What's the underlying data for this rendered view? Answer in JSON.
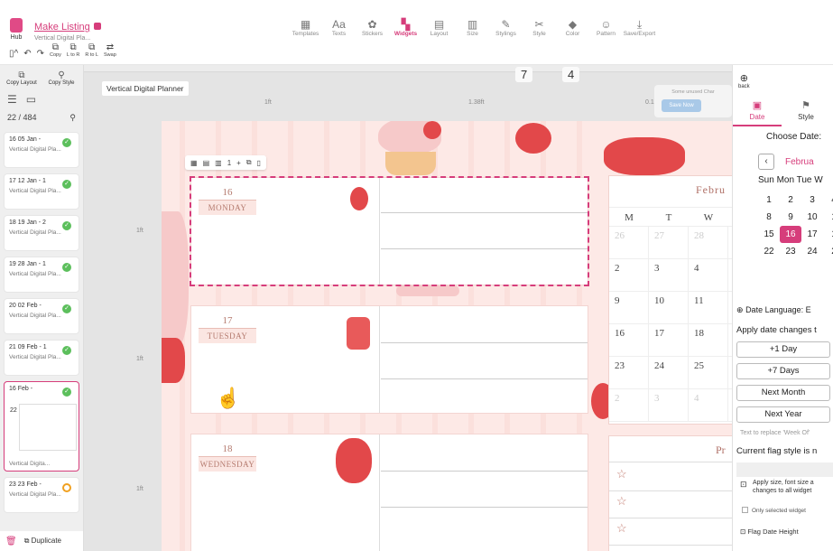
{
  "header": {
    "hub_label": "Hub",
    "title": "Make Listing",
    "subtitle": "Vertical Digital Pla...",
    "undo_items": [
      {
        "icon": "undo-icon",
        "label": ""
      },
      {
        "icon": "redo-icon",
        "label": ""
      },
      {
        "icon": "copy-icon",
        "label": "Copy"
      },
      {
        "icon": "left-to-right-icon",
        "label": "L to R"
      },
      {
        "icon": "right-to-left-icon",
        "label": "R to L"
      },
      {
        "icon": "swap-icon",
        "label": "Swap"
      }
    ],
    "tools": [
      {
        "label": "Templates",
        "icon": "templates-icon",
        "active": false
      },
      {
        "label": "Texts",
        "icon": "texts-icon",
        "active": false
      },
      {
        "label": "Stickers",
        "icon": "stickers-icon",
        "active": false
      },
      {
        "label": "Widgets",
        "icon": "widgets-icon",
        "active": true
      },
      {
        "label": "Layout",
        "icon": "layout-icon",
        "active": false
      },
      {
        "label": "Size",
        "icon": "size-icon",
        "active": false
      },
      {
        "label": "Stylings",
        "icon": "stylings-icon",
        "active": false
      },
      {
        "label": "Style",
        "icon": "style-icon",
        "active": false
      },
      {
        "label": "Color",
        "icon": "color-icon",
        "active": false
      },
      {
        "label": "Pattern",
        "icon": "pattern-icon",
        "active": false
      },
      {
        "label": "Save/Export",
        "icon": "save-export-icon",
        "active": false
      }
    ]
  },
  "sidebar": {
    "copy_layout": "Copy Layout",
    "copy_style": "Copy Style",
    "count": "22 / 484",
    "pages": [
      {
        "date": "16 05 Jan -",
        "name": "Vertical Digital Pla...",
        "status": "done"
      },
      {
        "date": "17 12 Jan - 1",
        "name": "Vertical Digital Pla...",
        "status": "done"
      },
      {
        "date": "18 19 Jan - 2",
        "name": "Vertical Digital Pla...",
        "status": "done"
      },
      {
        "date": "19 28 Jan - 1",
        "name": "Vertical Digital Pla...",
        "status": "done"
      },
      {
        "date": "20 02 Feb -",
        "name": "Vertical Digital Pla...",
        "status": "done"
      },
      {
        "date": "21 09 Feb - 1",
        "name": "Vertical Digital Pla...",
        "status": "done"
      }
    ],
    "selected_page": {
      "date": "16 Feb -",
      "num": "22",
      "name": "Vertical Digita..."
    },
    "last_page": {
      "date": "23 23 Feb -",
      "name": "Vertical Digital Pla...",
      "status": "pending"
    },
    "duplicate_label": "Duplicate"
  },
  "canvas": {
    "label": "Vertical Digital Planner",
    "coord_x": "7",
    "coord_y": "4",
    "ruler_labels": [
      "1ft",
      "1.38ft",
      "0.1"
    ],
    "side_labels": [
      "1ft",
      "1ft",
      "1ft"
    ],
    "unused_text": "Some unused Char",
    "unused_button": "Save Now",
    "mini_toolbar": [
      "1",
      "+"
    ],
    "days": [
      {
        "num": "16",
        "name": "MONDAY",
        "selected": true
      },
      {
        "num": "17",
        "name": "TUESDAY",
        "selected": false
      },
      {
        "num": "18",
        "name": "WEDNESDAY",
        "selected": false
      }
    ],
    "calendar": {
      "month": "Febru",
      "headers": [
        "M",
        "T",
        "W"
      ],
      "rows": [
        [
          {
            "v": "26",
            "dim": true
          },
          {
            "v": "27",
            "dim": true
          },
          {
            "v": "28",
            "dim": true
          }
        ],
        [
          {
            "v": "2",
            "dim": false
          },
          {
            "v": "3",
            "dim": false
          },
          {
            "v": "4",
            "dim": false
          }
        ],
        [
          {
            "v": "9",
            "dim": false
          },
          {
            "v": "10",
            "dim": false
          },
          {
            "v": "11",
            "dim": false
          }
        ],
        [
          {
            "v": "16",
            "dim": false
          },
          {
            "v": "17",
            "dim": false
          },
          {
            "v": "18",
            "dim": false
          }
        ],
        [
          {
            "v": "23",
            "dim": false
          },
          {
            "v": "24",
            "dim": false
          },
          {
            "v": "25",
            "dim": false
          }
        ],
        [
          {
            "v": "2",
            "dim": true
          },
          {
            "v": "3",
            "dim": true
          },
          {
            "v": "4",
            "dim": true
          }
        ]
      ]
    },
    "priorities_title": "Pr"
  },
  "rpanel": {
    "back": "back",
    "tabs": [
      {
        "label": "Date",
        "active": true
      },
      {
        "label": "Style",
        "active": false
      }
    ],
    "choose_date": "Choose Date:",
    "month": "Februa",
    "weekdays": "Sun Mon Tue W",
    "grid": [
      [
        "1",
        "2",
        "3",
        "4"
      ],
      [
        "8",
        "9",
        "10",
        "1"
      ],
      [
        "15",
        "16",
        "17",
        "1"
      ],
      [
        "22",
        "23",
        "24",
        "2"
      ]
    ],
    "selected_day": "16",
    "date_language": "Date Language:",
    "date_language_value": "E",
    "apply_changes": "Apply date changes t",
    "buttons": [
      "+1 Day",
      "+7 Days",
      "Next Month",
      "Next Year"
    ],
    "hint": "Text to replace 'Week Of'",
    "flag_style": "Current flag style is n",
    "apply_size_text": "Apply size, font size a changes to all widget",
    "only_selected": "Only selected widget",
    "flag_date_height": "Flag Date Height"
  }
}
